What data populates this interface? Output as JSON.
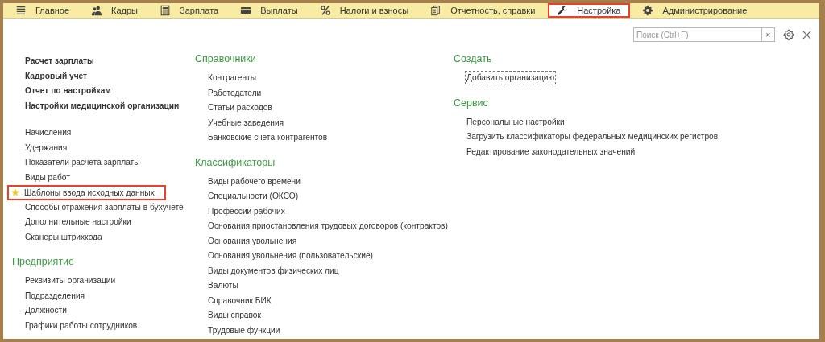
{
  "tabs": [
    {
      "label": "Главное",
      "selected": false,
      "highlighted": false
    },
    {
      "label": "Кадры",
      "selected": false,
      "highlighted": false
    },
    {
      "label": "Зарплата",
      "selected": false,
      "highlighted": false
    },
    {
      "label": "Выплаты",
      "selected": false,
      "highlighted": false
    },
    {
      "label": "Налоги и взносы",
      "selected": false,
      "highlighted": false
    },
    {
      "label": "Отчетность, справки",
      "selected": false,
      "highlighted": false
    },
    {
      "label": "Настройка",
      "selected": true,
      "highlighted": true
    },
    {
      "label": "Администрирование",
      "selected": false,
      "highlighted": false
    }
  ],
  "search": {
    "placeholder": "Поиск (Ctrl+F)",
    "clear": "×"
  },
  "columns": [
    [
      {
        "bold": true,
        "items": [
          {
            "label": "Расчет зарплаты"
          },
          {
            "label": "Кадровый учет"
          },
          {
            "label": "Отчет по настройкам"
          },
          {
            "label": "Настройки медицинской организации"
          }
        ]
      },
      {
        "bold": false,
        "items": [
          {
            "label": "Начисления",
            "favorite": false,
            "highlighted": false
          },
          {
            "label": "Удержания",
            "favorite": false,
            "highlighted": false
          },
          {
            "label": "Показатели расчета зарплаты",
            "favorite": false,
            "highlighted": false
          },
          {
            "label": "Виды работ",
            "favorite": false,
            "highlighted": false
          },
          {
            "label": "Шаблоны ввода исходных данных",
            "favorite": true,
            "highlighted": true
          },
          {
            "label": "Способы отражения зарплаты в бухучете",
            "favorite": false,
            "highlighted": false
          },
          {
            "label": "Дополнительные настройки",
            "favorite": false,
            "highlighted": false
          },
          {
            "label": "Сканеры штрихкода",
            "favorite": false,
            "highlighted": false
          }
        ]
      },
      {
        "title": "Предприятие",
        "bold": false,
        "items": [
          {
            "label": "Реквизиты организации"
          },
          {
            "label": "Подразделения"
          },
          {
            "label": "Должности"
          },
          {
            "label": "Графики работы сотрудников"
          }
        ]
      }
    ],
    [
      {
        "title": "Справочники",
        "bold": false,
        "items": [
          {
            "label": "Контрагенты"
          },
          {
            "label": "Работодатели"
          },
          {
            "label": "Статьи расходов"
          },
          {
            "label": "Учебные заведения"
          },
          {
            "label": "Банковские счета контрагентов"
          }
        ]
      },
      {
        "title": "Классификаторы",
        "bold": false,
        "items": [
          {
            "label": "Виды рабочего времени"
          },
          {
            "label": "Специальности (ОКСО)"
          },
          {
            "label": "Профессии рабочих"
          },
          {
            "label": "Основания приостановления трудовых договоров (контрактов)"
          },
          {
            "label": "Основания увольнения"
          },
          {
            "label": "Основания увольнения (пользовательские)"
          },
          {
            "label": "Виды документов физических лиц"
          },
          {
            "label": "Валюты"
          },
          {
            "label": "Справочник БИК"
          },
          {
            "label": "Виды справок"
          },
          {
            "label": "Трудовые функции"
          }
        ]
      }
    ],
    [
      {
        "title": "Создать",
        "bold": false,
        "items": [
          {
            "label": "Добавить организацию",
            "focused": true
          }
        ]
      },
      {
        "title": "Сервис",
        "bold": false,
        "items": [
          {
            "label": "Персональные настройки"
          },
          {
            "label": "Загрузить классификаторы федеральных медицинских регистров"
          },
          {
            "label": "Редактирование законодательных значений"
          }
        ]
      }
    ]
  ]
}
